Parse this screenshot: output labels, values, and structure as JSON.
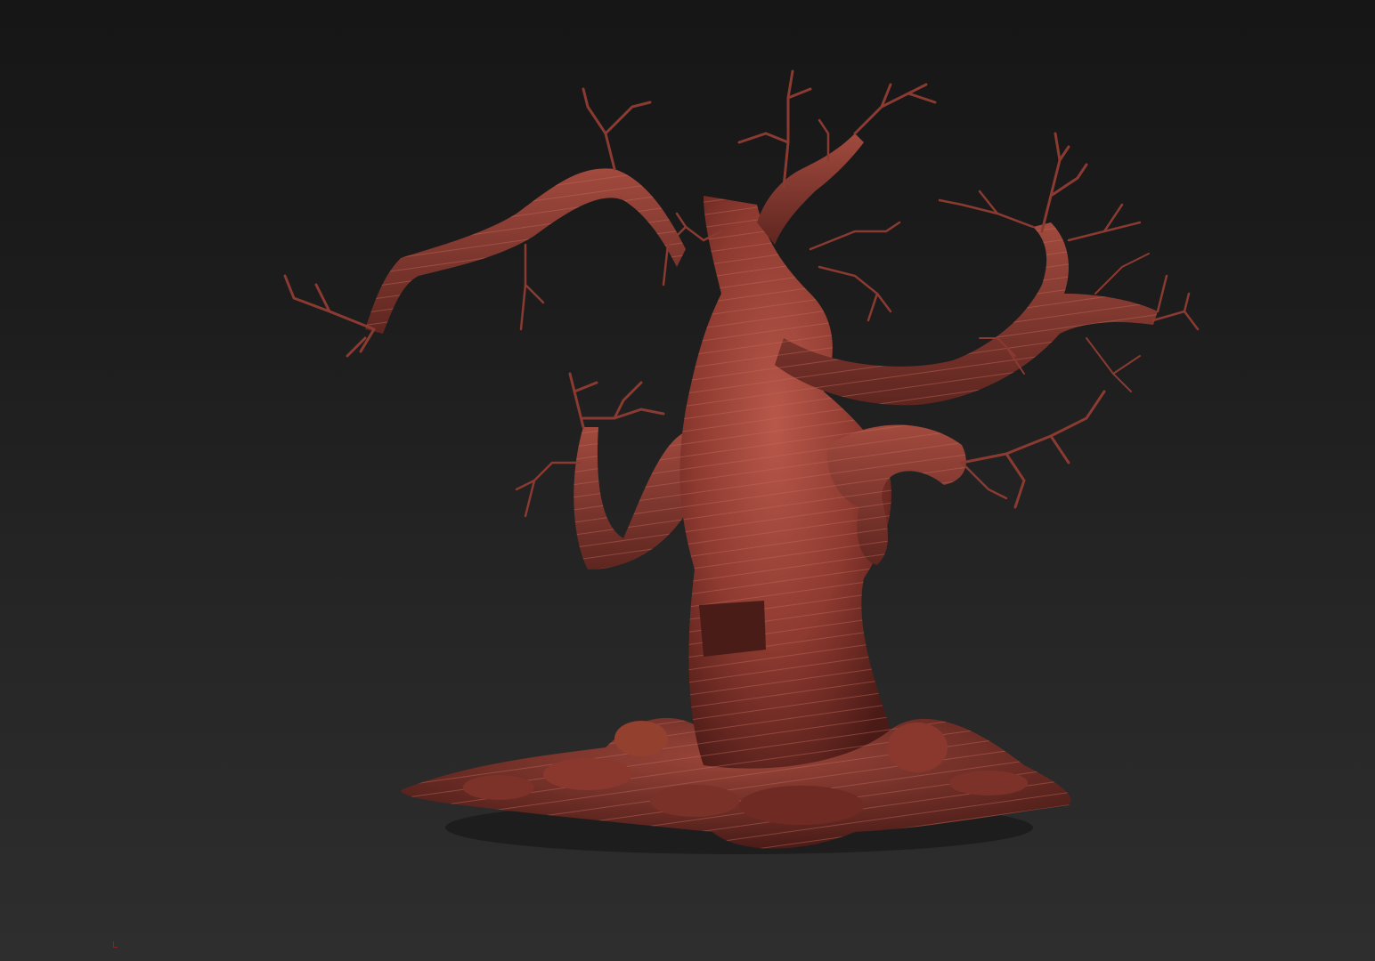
{
  "scene": {
    "subject": "tree-sculpt",
    "colors": {
      "background_top": "#161616",
      "background_bottom": "#2e2e2e",
      "material_base": "#8e3a30",
      "material_light": "#b8584a",
      "material_dark": "#4a1a16",
      "band_line": "#c06a5c"
    }
  },
  "viewport": {
    "axis_icon": "axis-gizmo-icon"
  }
}
